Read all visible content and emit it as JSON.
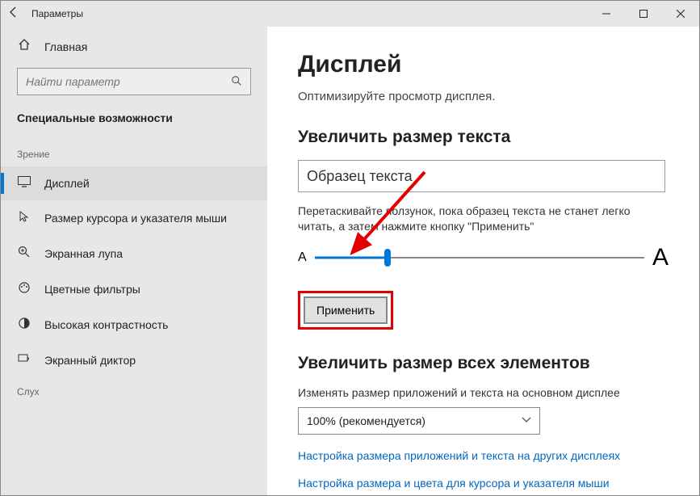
{
  "window": {
    "title": "Параметры"
  },
  "sidebar": {
    "home": "Главная",
    "search_placeholder": "Найти параметр",
    "category": "Специальные возможности",
    "group_vision": "Зрение",
    "group_hearing": "Слух",
    "items": [
      {
        "label": "Дисплей"
      },
      {
        "label": "Размер курсора и указателя мыши"
      },
      {
        "label": "Экранная лупа"
      },
      {
        "label": "Цветные фильтры"
      },
      {
        "label": "Высокая контрастность"
      },
      {
        "label": "Экранный диктор"
      }
    ]
  },
  "content": {
    "heading": "Дисплей",
    "subtitle": "Оптимизируйте просмотр дисплея.",
    "section1_title": "Увеличить размер текста",
    "sample": "Образец текста",
    "instruction": "Перетаскивайте ползунок, пока образец текста не станет легко читать, а затем нажмите кнопку \"Применить\"",
    "small_a": "A",
    "big_a": "A",
    "apply": "Применить",
    "section2_title": "Увеличить размер всех элементов",
    "desc2": "Изменять размер приложений и текста на основном дисплее",
    "scale_value": "100% (рекомендуется)",
    "link1": "Настройка размера приложений и текста на других дисплеях",
    "link2": "Настройка размера и цвета для курсора и указателя мыши"
  }
}
